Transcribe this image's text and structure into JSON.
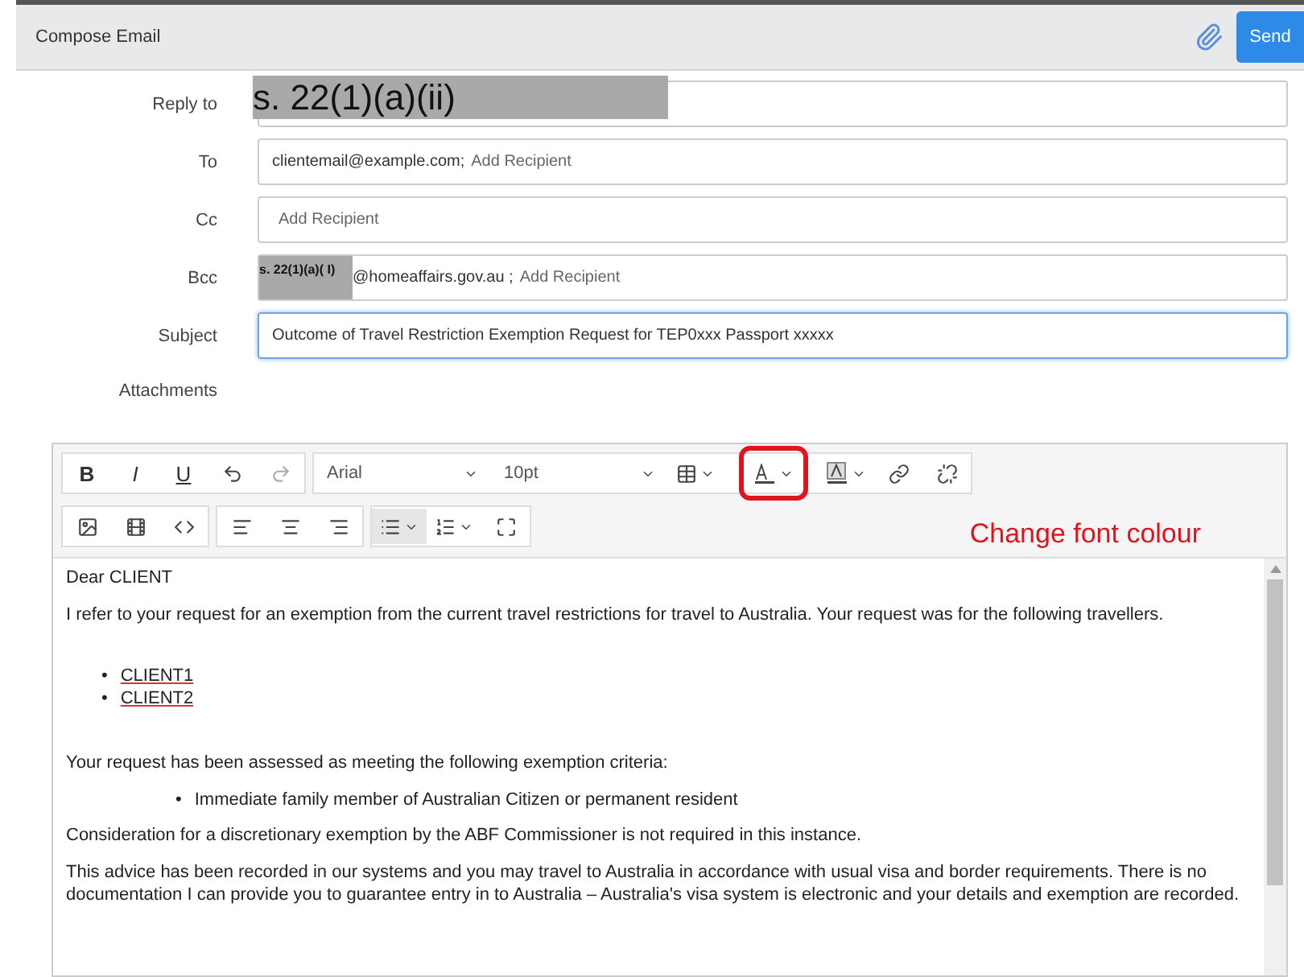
{
  "header": {
    "title": "Compose Email",
    "send": "Send"
  },
  "fields": [
    {
      "kind": "redacted",
      "label": "Reply to",
      "redaction": "s. 22(1)(a)(ii)",
      "focused": false
    },
    {
      "kind": "recipients",
      "label": "To",
      "value": "clientemail@example.com;",
      "placeholder": "Add Recipient",
      "focused": false
    },
    {
      "kind": "recipients",
      "label": "Cc",
      "placeholder": "Add Recipient",
      "focused": false
    },
    {
      "kind": "recipients",
      "label": "Bcc",
      "redaction": "s. 22(1)(a)( I)",
      "value": "@homeaffairs.gov.au ;",
      "placeholder": "Add Recipient",
      "focused": false
    },
    {
      "kind": "text",
      "label": "Subject",
      "value": "Outcome of Travel Restriction Exemption Request for TEP0xxx Passport xxxxx",
      "focused": true
    }
  ],
  "attachments_label": "Attachments",
  "toolbar": {
    "bold": "B",
    "italic": "I",
    "underline": "U",
    "font": "Arial",
    "size": "10pt",
    "font_colour_highlighted": true
  },
  "annotation": "Change font colour",
  "body": [
    {
      "kind": "p",
      "text": "Dear CLIENT"
    },
    {
      "kind": "p",
      "text": "I refer to your request for an exemption from the current travel restrictions for travel to Australia.  Your request was for the following travellers."
    },
    {
      "kind": "ul",
      "bullet": "•",
      "items": [
        "CLIENT1",
        "CLIENT2"
      ],
      "underlined": true
    },
    {
      "kind": "p",
      "text": "Your request has been assessed as meeting the following exemption criteria:"
    },
    {
      "kind": "ul",
      "bullet": "•",
      "items": [
        "Immediate family member of Australian Citizen or permanent resident"
      ],
      "underlined": false
    },
    {
      "kind": "p",
      "text": "Consideration for a discretionary exemption by the ABF Commissioner is not required in this instance."
    },
    {
      "kind": "p",
      "text": "This advice has been recorded in our systems and you may travel to Australia in accordance with usual visa and border requirements. There is no documentation I can provide you to guarantee entry in to Australia – Australia's visa system is electronic and your details and exemption are recorded."
    }
  ]
}
